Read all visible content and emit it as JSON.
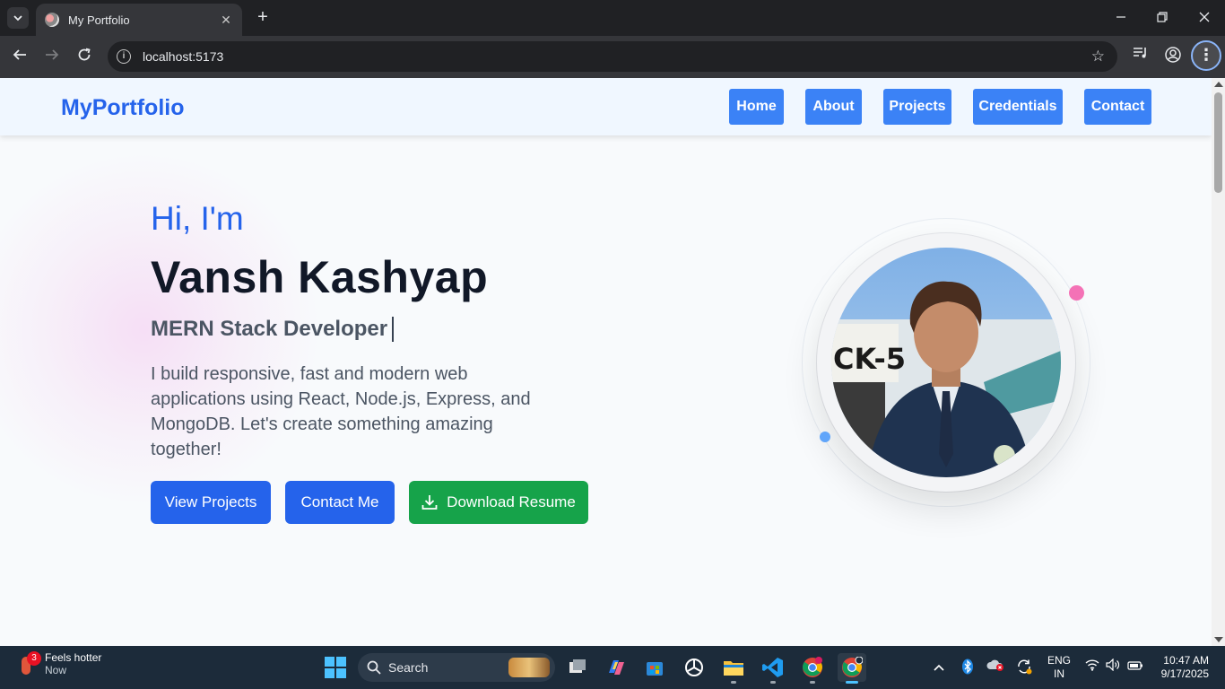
{
  "browser": {
    "tab_title": "My Portfolio",
    "url": "localhost:5173"
  },
  "site": {
    "brand": "MyPortfolio",
    "nav": [
      "Home",
      "About",
      "Projects",
      "Credentials",
      "Contact"
    ]
  },
  "hero": {
    "greeting": "Hi, I'm",
    "name": "Vansh Kashyap",
    "role": "MERN Stack Developer",
    "description": "I build responsive, fast and modern web applications using React, Node.js, Express, and MongoDB. Let's create something amazing together!",
    "buttons": {
      "view_projects": "View Projects",
      "contact_me": "Contact Me",
      "download_resume": "Download Resume"
    },
    "photo_sign": "CK-5"
  },
  "colors": {
    "accent_blue": "#2563eb",
    "nav_blue": "#3b82f6",
    "green": "#16a34a",
    "pink_dot": "#f472b6",
    "blue_dot": "#60a5fa"
  },
  "taskbar": {
    "weather_badge": "3",
    "weather_title": "Feels hotter",
    "weather_sub": "Now",
    "search_placeholder": "Search",
    "lang_line1": "ENG",
    "lang_line2": "IN",
    "time": "10:47 AM",
    "date": "9/17/2025",
    "apps": [
      "task-view-icon",
      "copilot-icon",
      "microsoft-store-icon",
      "chatgpt-icon",
      "file-explorer-icon",
      "vscode-icon",
      "chrome-icon",
      "chrome-profile-icon"
    ]
  }
}
